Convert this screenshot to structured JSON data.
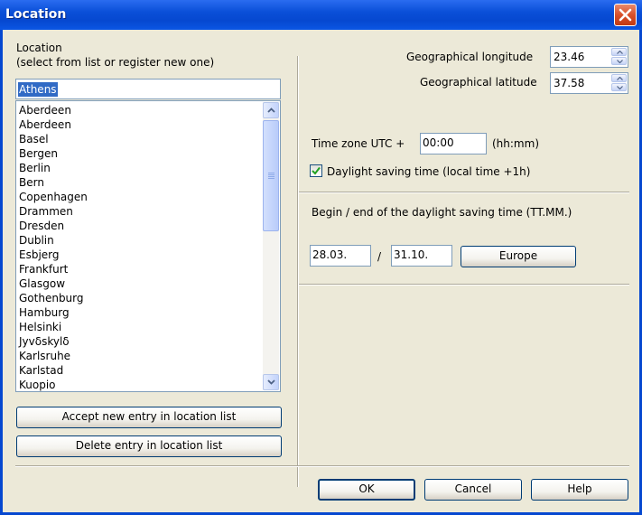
{
  "window": {
    "title": "Location"
  },
  "location": {
    "heading_line1": "Location",
    "heading_line2": "(select from list or register new one)",
    "input_value": "Athens",
    "items": [
      "Aberdeen",
      "Aberdeen",
      "Basel",
      "Bergen",
      "Berlin",
      "Bern",
      "Copenhagen",
      "Drammen",
      "Dresden",
      "Dublin",
      "Esbjerg",
      "Frankfurt",
      "Glasgow",
      "Gothenburg",
      "Hamburg",
      "Helsinki",
      "Jyvδskylδ",
      "Karlsruhe",
      "Karlstad",
      "Kuopio"
    ],
    "accept_button": "Accept new entry in location list",
    "delete_button": "Delete entry in location list"
  },
  "coordinates": {
    "longitude_label": "Geographical longitude",
    "longitude_value": "23.46",
    "latitude_label": "Geographical latitude",
    "latitude_value": "37.58"
  },
  "timezone": {
    "label": "Time zone UTC +",
    "value": "00:00",
    "format_hint": "(hh:mm)",
    "dst_checkbox_label": "Daylight saving time (local time +1h)",
    "dst_checked": true
  },
  "dst_period": {
    "label": "Begin / end of the daylight saving time (TT.MM.)",
    "begin": "28.03.",
    "separator": "/",
    "end": "31.10.",
    "preset_button": "Europe"
  },
  "footer": {
    "ok": "OK",
    "cancel": "Cancel",
    "help": "Help"
  },
  "colors": {
    "titlebar": "#0a4fd8",
    "dialog_bg": "#ece9d8",
    "selection": "#316ac5",
    "close_button": "#d8502a"
  }
}
